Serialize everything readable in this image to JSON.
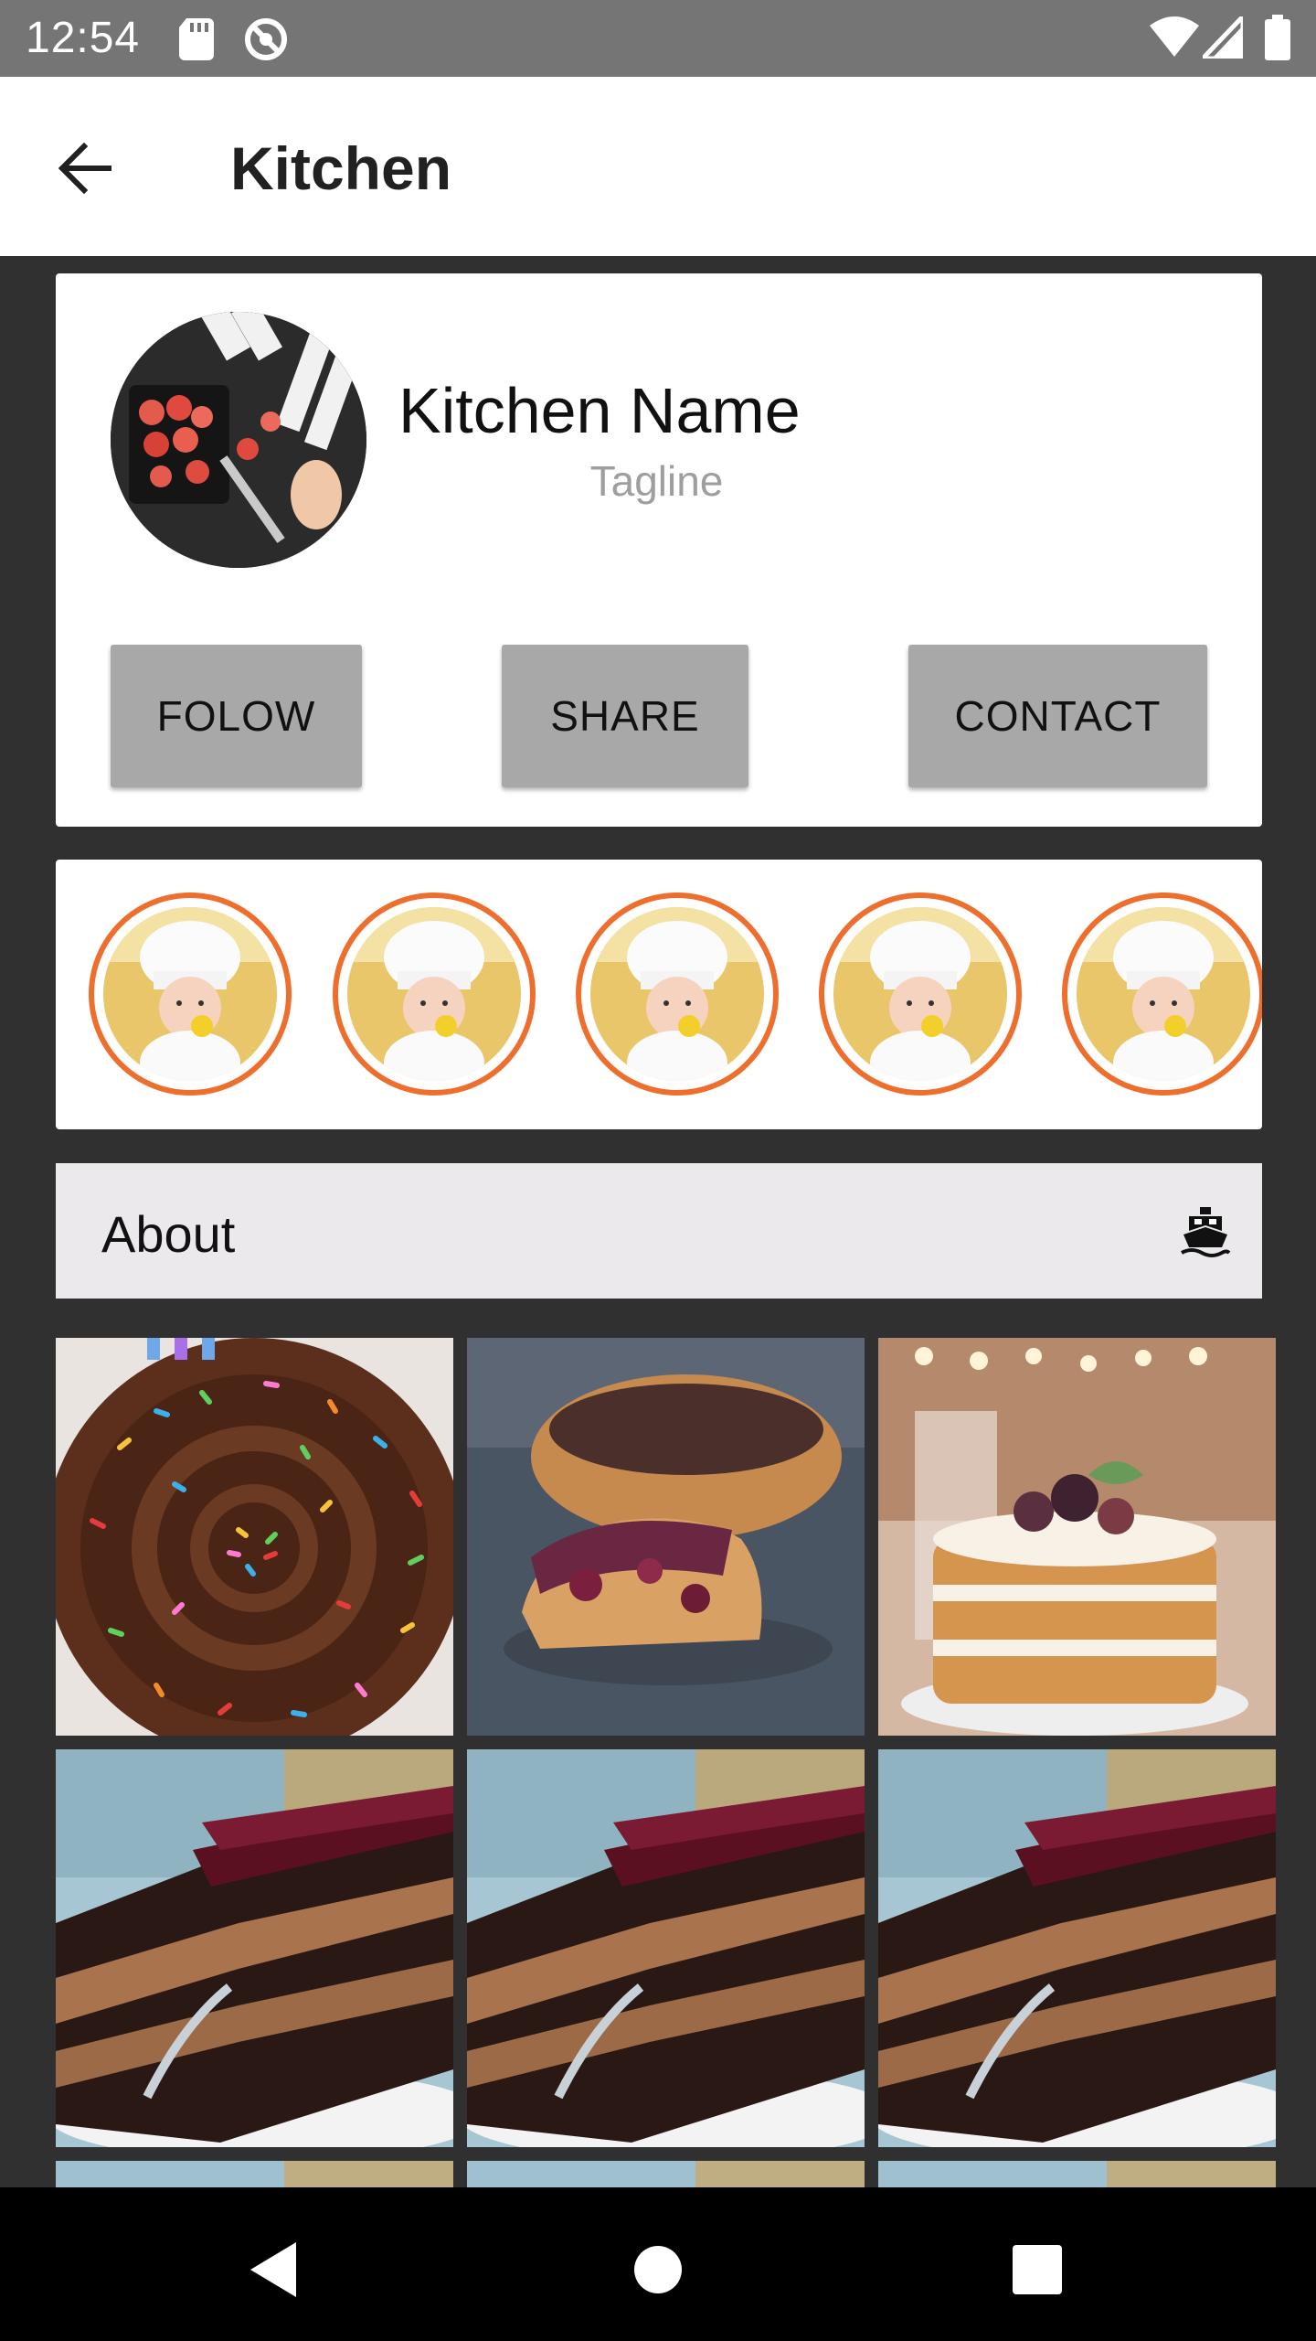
{
  "status_bar": {
    "time": "12:54",
    "icons": [
      "sd-card-icon",
      "no-sync-icon",
      "wifi-icon",
      "signal-icon",
      "battery-icon"
    ]
  },
  "app_bar": {
    "back_icon": "arrow-back-icon",
    "title": "Kitchen"
  },
  "profile": {
    "name": "Kitchen Name",
    "tagline": "Tagline",
    "buttons": {
      "follow": "FOLOW",
      "share": "SHARE",
      "contact": "CONTACT"
    }
  },
  "stories": {
    "count_visible": 5,
    "ring_color": "#ee6f2d"
  },
  "about": {
    "label": "About",
    "icon": "ship-icon"
  },
  "gallery": {
    "tiles": [
      "sprinkle-chocolate-cake",
      "berry-muffin",
      "naked-layer-cake",
      "chocolate-layer-cake",
      "chocolate-layer-cake",
      "chocolate-layer-cake"
    ]
  },
  "nav_bar": {
    "icons": [
      "back-triangle-icon",
      "home-circle-icon",
      "recents-square-icon"
    ]
  }
}
